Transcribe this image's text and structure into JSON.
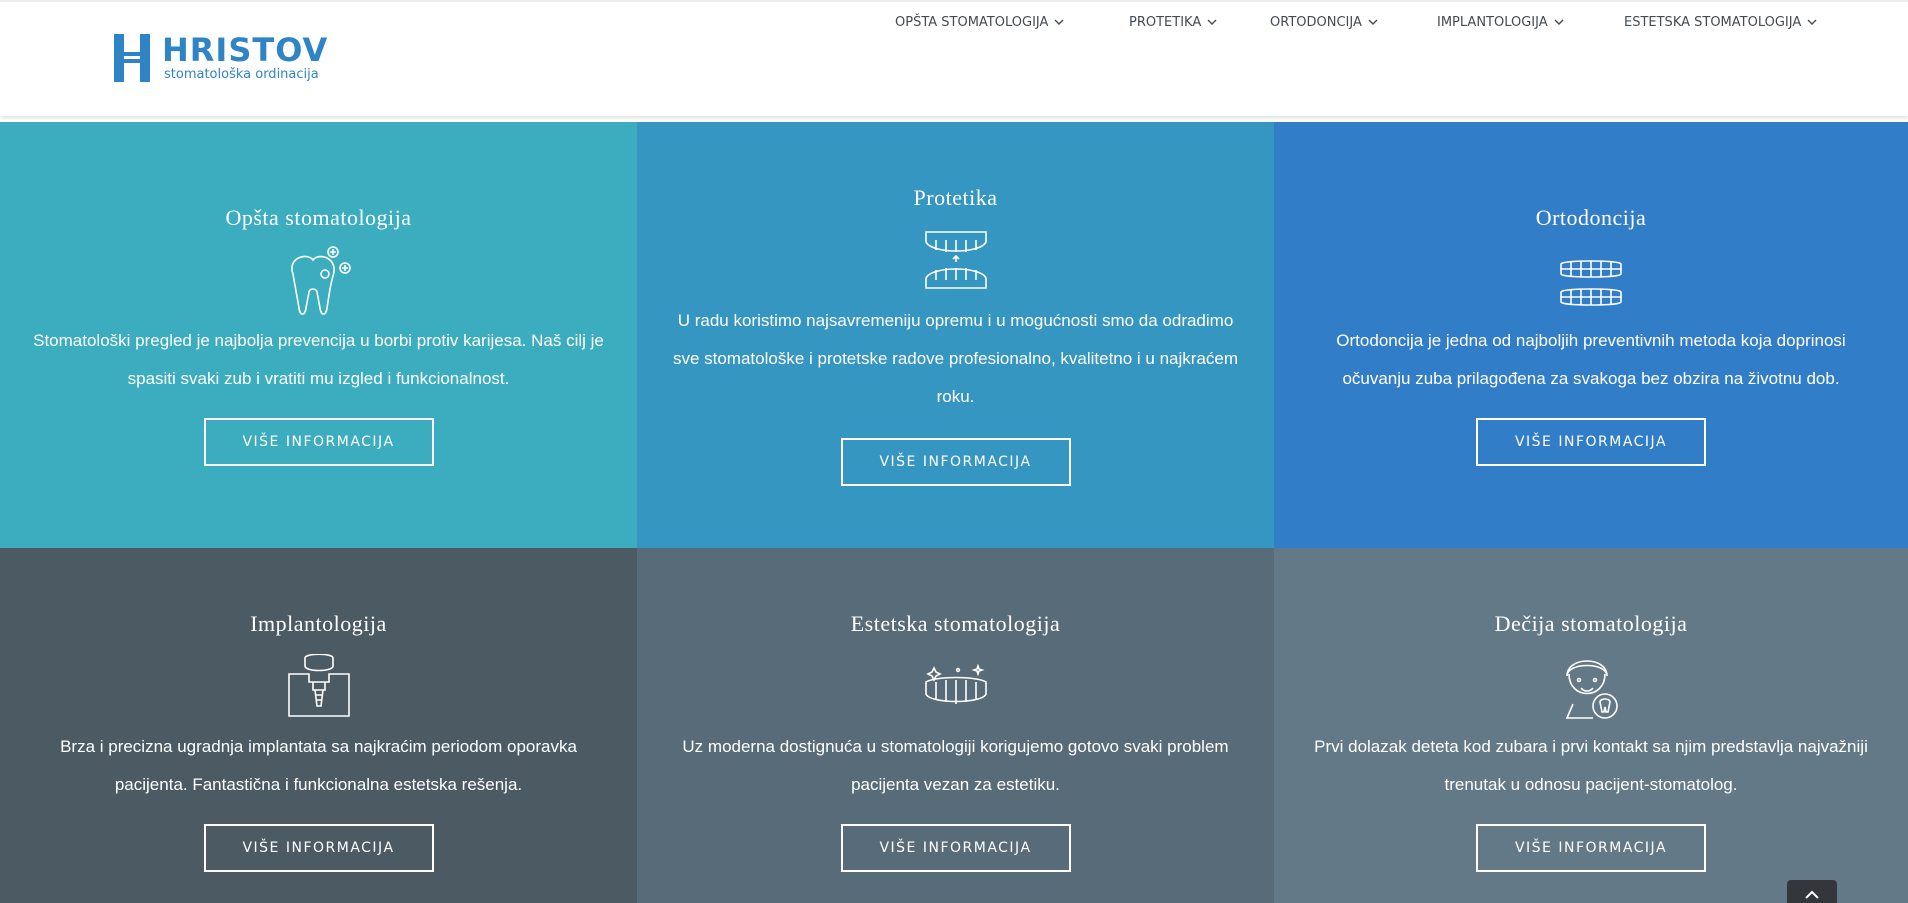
{
  "logo": {
    "title": "HRISTOV",
    "subtitle": "stomatološka ordinacija"
  },
  "nav": {
    "items": [
      {
        "label": "OPŠTA STOMATOLOGIJA"
      },
      {
        "label": "PROTETIKA"
      },
      {
        "label": "ORTODONCIJA"
      },
      {
        "label": "IMPLANTOLOGIJA"
      },
      {
        "label": "ESTETSKA STOMATOLOGIJA"
      }
    ]
  },
  "colors": {
    "brand": "#2f84c5",
    "cell1": "#3badbf",
    "cell2": "#3596c2",
    "cell3": "#327dc8",
    "cell4": "#4c5a63",
    "cell5": "#586b78",
    "cell6": "#647987"
  },
  "services": [
    {
      "title": "Opšta stomatologija",
      "icon": "tooth-sparkle-icon",
      "text": "Stomatološki pregled je najbolja prevencija u borbi protiv karijesa. Naš cilj je spasiti svaki zub i vratiti mu izgled i funkcionalnost.",
      "button": "VIŠE INFORMACIJA"
    },
    {
      "title": "Protetika",
      "icon": "dentures-icon",
      "text": "U radu koristimo najsavremeniju opremu i u mogućnosti smo da odradimo sve stomatološke i protetske radove profesionalno, kvalitetno i u najkraćem roku.",
      "button": "VIŠE INFORMACIJA"
    },
    {
      "title": "Ortodoncija",
      "icon": "braces-icon",
      "text": "Ortodoncija je jedna od najboljih preventivnih metoda koja doprinosi očuvanju zuba prilagođena za svakoga bez obzira na životnu dob.",
      "button": "VIŠE INFORMACIJA"
    },
    {
      "title": "Implantologija",
      "icon": "implant-icon",
      "text": "Brza i precizna ugradnja implantata sa najkraćim periodom oporavka pacijenta. Fantastična i funkcionalna estetska rešenja.",
      "button": "VIŠE INFORMACIJA"
    },
    {
      "title": "Estetska stomatologija",
      "icon": "sparkling-teeth-icon",
      "text": "Uz moderna dostignuća u stomatologiji korigujemo gotovo svaki problem pacijenta vezan za estetiku.",
      "button": "VIŠE INFORMACIJA"
    },
    {
      "title": "Dečija stomatologija",
      "icon": "child-tooth-icon",
      "text": "Prvi dolazak deteta kod zubara i prvi kontakt sa njim predstavlja najvažniji trenutak u odnosu pacijent-stomatolog.",
      "button": "VIŠE INFORMACIJA"
    }
  ],
  "scroll_top": {
    "icon": "chevron-up-icon"
  }
}
